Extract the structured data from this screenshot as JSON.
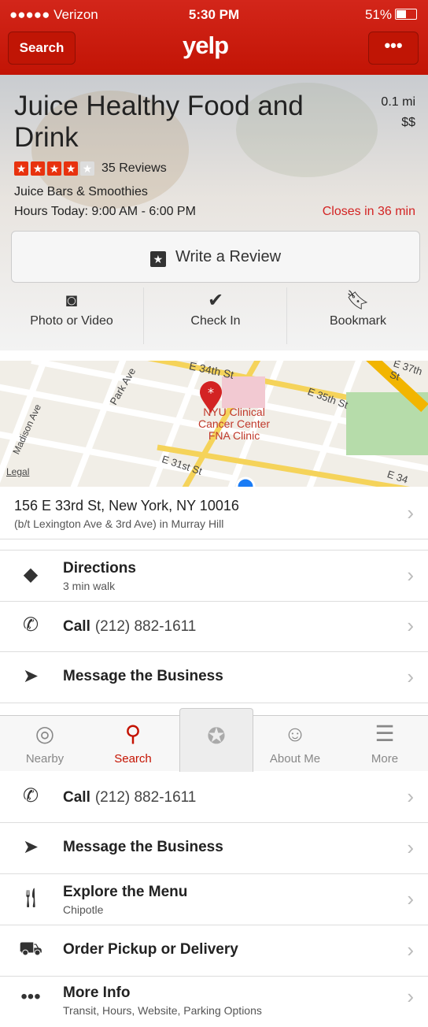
{
  "status_bar": {
    "carrier": "●●●●● Verizon",
    "time": "5:30 PM",
    "battery": "51%"
  },
  "nav": {
    "back_label": "Search",
    "logo": "yelp",
    "more_label": "•••"
  },
  "business": {
    "name": "Juice Healthy Food and Drink",
    "distance": "0.1 mi",
    "price": "$$",
    "rating": 4,
    "reviews": "35 Reviews",
    "category": "Juice Bars & Smoothies",
    "hours": "Hours Today: 9:00 AM - 6:00 PM",
    "closes": "Closes in 36 min"
  },
  "write_review": "Write a Review",
  "actions": [
    {
      "label": "Photo or Video",
      "icon": "camera-icon"
    },
    {
      "label": "Check In",
      "icon": "check-badge-icon"
    },
    {
      "label": "Bookmark",
      "icon": "bookmark-icon"
    }
  ],
  "map": {
    "legal": "Legal",
    "streets": [
      "E 34th St",
      "Park Ave",
      "E 35th St",
      "Madison Ave",
      "E 31st St",
      "E 37th St",
      "E 34"
    ],
    "place": [
      "NYU Clinical",
      "Cancer Center",
      "FNA Clinic"
    ]
  },
  "address": {
    "line1": "156 E 33rd St, New York, NY 10016",
    "line2": "(b/t Lexington Ave & 3rd Ave) in Murray Hill"
  },
  "rows_top": [
    {
      "title": "Directions",
      "sub": "3 min walk",
      "icon": "directions-icon"
    },
    {
      "title": "Call",
      "extra": "(212) 882-1611",
      "icon": "phone-icon"
    },
    {
      "title": "Message the Business",
      "icon": "send-icon"
    }
  ],
  "tabs": [
    {
      "label": "Nearby",
      "icon": "compass-icon"
    },
    {
      "label": "Search",
      "icon": "search-icon"
    },
    {
      "label": "",
      "icon": "check-in-star-icon"
    },
    {
      "label": "About Me",
      "icon": "person-icon"
    },
    {
      "label": "More",
      "icon": "menu-icon"
    }
  ],
  "rows_bottom": [
    {
      "title": "Call",
      "extra": "(212) 882-1611",
      "icon": "phone-icon"
    },
    {
      "title": "Message the Business",
      "icon": "send-icon"
    },
    {
      "title": "Explore the Menu",
      "sub": "Chipotle",
      "icon": "menu-fork-icon"
    },
    {
      "title": "Order Pickup or Delivery",
      "icon": "delivery-truck-icon"
    },
    {
      "title": "More Info",
      "sub": "Transit, Hours, Website, Parking Options",
      "icon": "more-dots-icon"
    }
  ]
}
